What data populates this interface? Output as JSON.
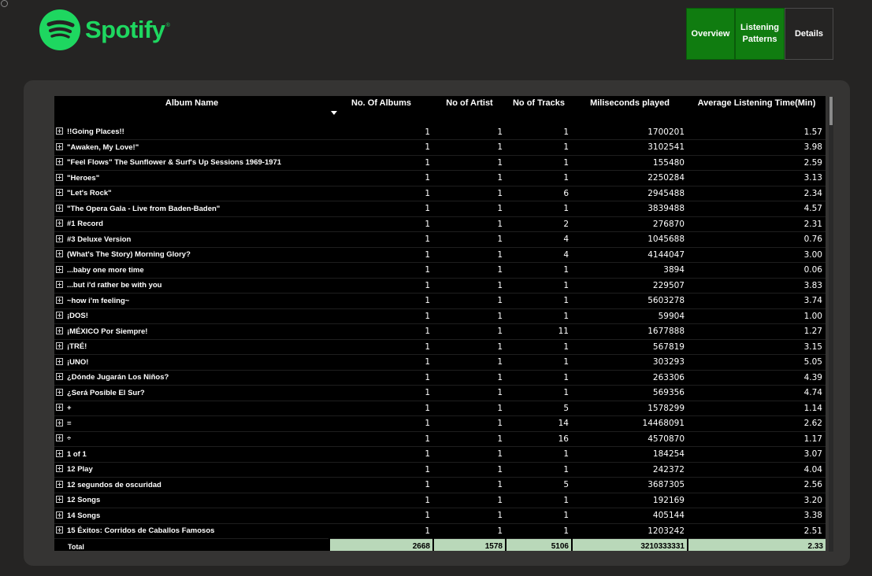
{
  "brand": {
    "name": "Spotify",
    "tm": "®",
    "color": "#1ED760"
  },
  "nav": {
    "items": [
      {
        "label": "Overview",
        "active": true
      },
      {
        "label": "Listening Patterns",
        "active": true
      },
      {
        "label": "Details",
        "active": false
      }
    ]
  },
  "table": {
    "headers": [
      "Album Name",
      "No. Of Albums",
      "No of Artist",
      "No of Tracks",
      "Miliseconds played",
      "Average Listening Time(Min)"
    ],
    "sort": {
      "column": "Album Name",
      "direction": "descending-arrow"
    },
    "rows": [
      {
        "name": "!!Going Places!!",
        "albums": "1",
        "artists": "1",
        "tracks": "1",
        "ms": "1700201",
        "avg": "1.57"
      },
      {
        "name": "\"Awaken, My Love!\"",
        "albums": "1",
        "artists": "1",
        "tracks": "1",
        "ms": "3102541",
        "avg": "3.98"
      },
      {
        "name": "\"Feel Flows\" The Sunflower & Surf's Up Sessions 1969-1971",
        "albums": "1",
        "artists": "1",
        "tracks": "1",
        "ms": "155480",
        "avg": "2.59"
      },
      {
        "name": "\"Heroes\"",
        "albums": "1",
        "artists": "1",
        "tracks": "1",
        "ms": "2250284",
        "avg": "3.13"
      },
      {
        "name": "\"Let's Rock\"",
        "albums": "1",
        "artists": "1",
        "tracks": "6",
        "ms": "2945488",
        "avg": "2.34"
      },
      {
        "name": "\"The Opera Gala - Live from Baden-Baden\"",
        "albums": "1",
        "artists": "1",
        "tracks": "1",
        "ms": "3839488",
        "avg": "4.57"
      },
      {
        "name": "#1 Record",
        "albums": "1",
        "artists": "1",
        "tracks": "2",
        "ms": "276870",
        "avg": "2.31"
      },
      {
        "name": "#3 Deluxe Version",
        "albums": "1",
        "artists": "1",
        "tracks": "4",
        "ms": "1045688",
        "avg": "0.76"
      },
      {
        "name": "(What's The Story) Morning Glory?",
        "albums": "1",
        "artists": "1",
        "tracks": "4",
        "ms": "4144047",
        "avg": "3.00"
      },
      {
        "name": "...baby one more time",
        "albums": "1",
        "artists": "1",
        "tracks": "1",
        "ms": "3894",
        "avg": "0.06"
      },
      {
        "name": "...but i'd rather be with you",
        "albums": "1",
        "artists": "1",
        "tracks": "1",
        "ms": "229507",
        "avg": "3.83"
      },
      {
        "name": "~how i'm feeling~",
        "albums": "1",
        "artists": "1",
        "tracks": "1",
        "ms": "5603278",
        "avg": "3.74"
      },
      {
        "name": "¡DOS!",
        "albums": "1",
        "artists": "1",
        "tracks": "1",
        "ms": "59904",
        "avg": "1.00"
      },
      {
        "name": "¡MÉXICO Por Siempre!",
        "albums": "1",
        "artists": "1",
        "tracks": "11",
        "ms": "1677888",
        "avg": "1.27"
      },
      {
        "name": "¡TRÉ!",
        "albums": "1",
        "artists": "1",
        "tracks": "1",
        "ms": "567819",
        "avg": "3.15"
      },
      {
        "name": "¡UNO!",
        "albums": "1",
        "artists": "1",
        "tracks": "1",
        "ms": "303293",
        "avg": "5.05"
      },
      {
        "name": "¿Dónde Jugarán Los Niños?",
        "albums": "1",
        "artists": "1",
        "tracks": "1",
        "ms": "263306",
        "avg": "4.39"
      },
      {
        "name": "¿Será Posible El Sur?",
        "albums": "1",
        "artists": "1",
        "tracks": "1",
        "ms": "569356",
        "avg": "4.74"
      },
      {
        "name": "+",
        "albums": "1",
        "artists": "1",
        "tracks": "5",
        "ms": "1578299",
        "avg": "1.14"
      },
      {
        "name": "=",
        "albums": "1",
        "artists": "1",
        "tracks": "14",
        "ms": "14468091",
        "avg": "2.62"
      },
      {
        "name": "÷",
        "albums": "1",
        "artists": "1",
        "tracks": "16",
        "ms": "4570870",
        "avg": "1.17"
      },
      {
        "name": "1 of 1",
        "albums": "1",
        "artists": "1",
        "tracks": "1",
        "ms": "184254",
        "avg": "3.07"
      },
      {
        "name": "12 Play",
        "albums": "1",
        "artists": "1",
        "tracks": "1",
        "ms": "242372",
        "avg": "4.04"
      },
      {
        "name": "12 segundos de oscuridad",
        "albums": "1",
        "artists": "1",
        "tracks": "5",
        "ms": "3687305",
        "avg": "2.56"
      },
      {
        "name": "12 Songs",
        "albums": "1",
        "artists": "1",
        "tracks": "1",
        "ms": "192169",
        "avg": "3.20"
      },
      {
        "name": "14 Songs",
        "albums": "1",
        "artists": "1",
        "tracks": "1",
        "ms": "405144",
        "avg": "3.38"
      },
      {
        "name": "15 Éxitos: Corridos de Caballos Famosos",
        "albums": "1",
        "artists": "1",
        "tracks": "1",
        "ms": "1203242",
        "avg": "2.51"
      }
    ],
    "total": {
      "label": "Total",
      "albums": "2668",
      "artists": "1578",
      "tracks": "5106",
      "ms": "3210333331",
      "avg": "2.33"
    }
  }
}
